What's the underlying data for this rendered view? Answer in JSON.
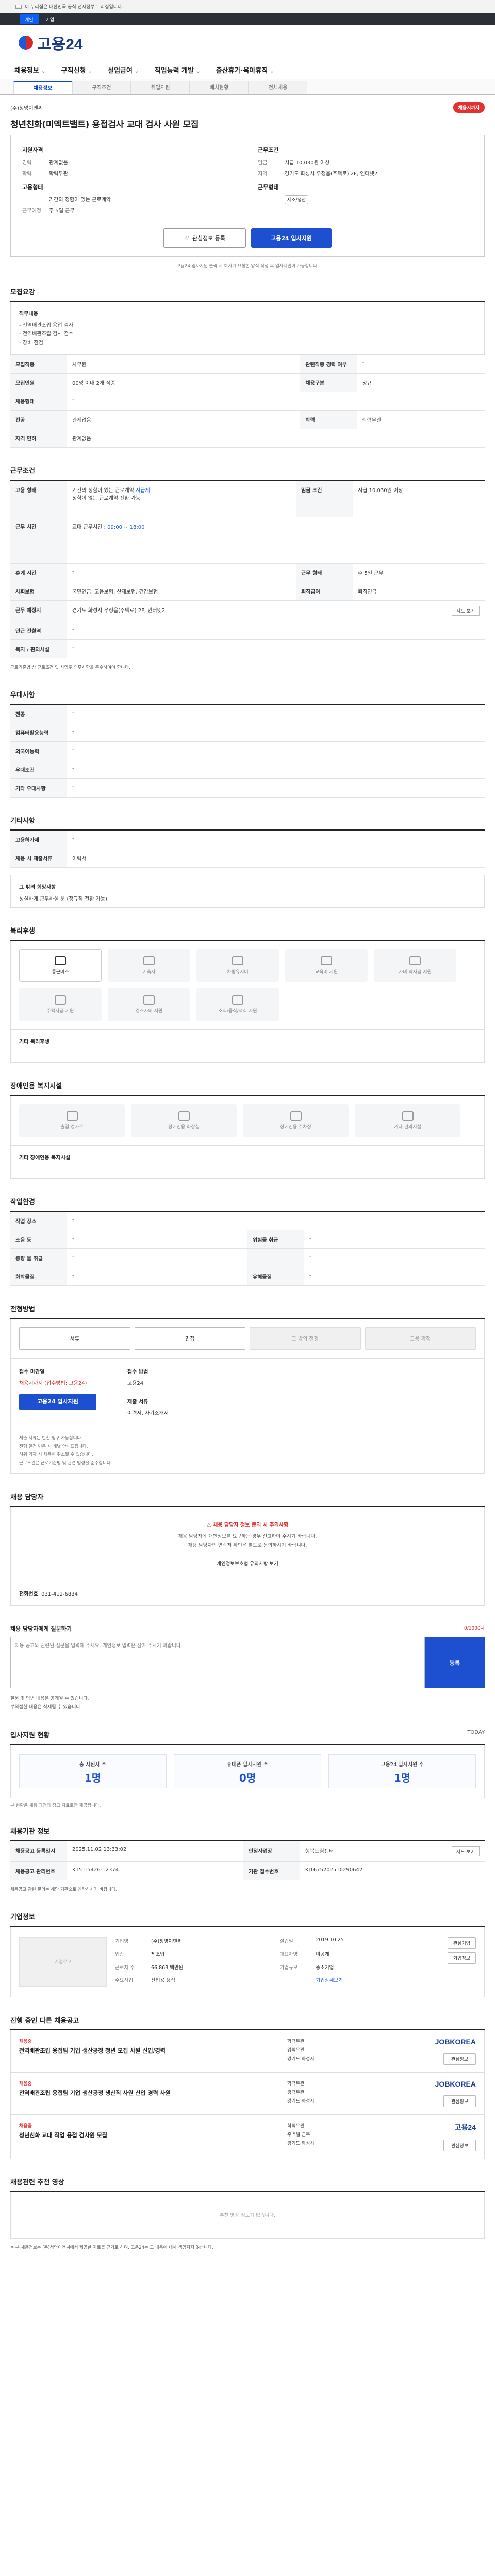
{
  "topbar": {
    "notice": "이 누리집은 대한민국 공식 전자정부 누리집입니다."
  },
  "util": {
    "items": [
      "개인",
      "기업"
    ]
  },
  "logo": {
    "text": "고용24"
  },
  "gnb": {
    "items": [
      "채용정보",
      "구직신청",
      "실업급여",
      "직업능력 개발",
      "출산휴가·육아휴직"
    ]
  },
  "subtabs": {
    "items": [
      "채용정보",
      "구직조건",
      "취업지원",
      "배치현황",
      "전체채용"
    ]
  },
  "job": {
    "company": "(주)청명이앤씨",
    "badge": "채용시까지",
    "title": "청년친화(미엑트밸트) 용접검사 교대 검사 사원 모집",
    "left_head": "지원자격",
    "right_head": "근무조건",
    "left": [
      {
        "k": "경력",
        "v": "관계없음"
      },
      {
        "k": "학력",
        "v": "학력무관"
      }
    ],
    "right": [
      {
        "k": "임금",
        "v": "시급 10,030원 이상"
      },
      {
        "k": "지역",
        "v": "경기도 화성시 우정읍(주택로) 2F, 인터넷2"
      }
    ],
    "left2_head": "고용형태",
    "right2_head": "근무형태",
    "left2": [
      {
        "k": "",
        "v": "기간의 정함이 있는 근로계약"
      },
      {
        "k": "근무예정",
        "v": "주 5일 근무"
      }
    ],
    "right2": [
      {
        "k": "",
        "v": "제조/생산"
      }
    ]
  },
  "buttons": {
    "interest": "관심정보 등록",
    "apply": "고용24 입사지원"
  },
  "note": "고용24 입사지원 클릭 시 회사가 요청한 양식 작성 후 입사지원이 가능합니다.",
  "recruit": {
    "title": "모집요강",
    "duty_label": "직무내용",
    "duties": [
      "전역배관조립 용접 검사",
      "전역배관조립 검사 검수",
      "장비 점검"
    ],
    "rows": [
      [
        "모집직종",
        "사무원",
        "관련직종 경력 여부",
        "-"
      ],
      [
        "모집인원",
        "00명 이내 2개 직종",
        "채용구분",
        "정규"
      ],
      [
        "채용형태",
        "-",
        "",
        ""
      ],
      [
        "전공",
        "관계없음",
        "학력",
        "학력무관"
      ],
      [
        "자격 면허",
        "관계없음",
        "",
        ""
      ]
    ]
  },
  "work": {
    "title": "근무조건",
    "rows": [
      {
        "h": "고용 형태",
        "v": "기간의 정함이 있는 근로계약 ",
        "b": "시급제",
        "tail": "정함이 없는 근로계약 전환 가능",
        "h2": "임금 조건",
        "v2": "시급 10,030원 이상"
      },
      {
        "h": "근무 시간",
        "v": "교대 근무시간 : ",
        "b": "09:00 ~ 18:00",
        "tail": "",
        "h2": "",
        "v2": ""
      },
      {
        "h": "휴게 시간",
        "v": "-",
        "h2": "근무 형태",
        "v2": "주 5일 근무"
      },
      {
        "h": "사회보험",
        "v": "국민연금, 고용보험, 산재보험, 건강보험",
        "h2": "퇴직급여",
        "v2": "퇴직연금"
      },
      {
        "h": "근무 예정지",
        "v": "경기도 화성시 우정읍(주택로) 2F, 인터넷2",
        "h2": "",
        "v2": ""
      },
      {
        "h": "인근 전철역",
        "v": "-",
        "h2": "",
        "v2": ""
      },
      {
        "h": "복지 / 편의시설",
        "v": "-",
        "h2": "",
        "v2": ""
      }
    ],
    "map": "지도 보기",
    "foot": "근로기준법 상 근로조건 및 사업주 의무사항을 준수하여야 합니다."
  },
  "pref": {
    "title": "우대사항",
    "rows": [
      [
        "전공",
        "-"
      ],
      [
        "컴퓨터활용능력",
        "-"
      ],
      [
        "외국어능력",
        "-"
      ],
      [
        "우대조건",
        "-"
      ],
      [
        "기타 우대사항",
        "-"
      ]
    ]
  },
  "misc": {
    "title": "기타사항",
    "rows": [
      [
        "고용허가제",
        "-"
      ],
      [
        "채용 시 제출서류",
        "이력서"
      ]
    ]
  },
  "notes_box": {
    "label": "그 밖의 희망사항",
    "text": "성실하게 근무하실 분 (정규직 전환 가능)"
  },
  "welfare": {
    "title": "복리후생",
    "items": [
      "통근버스",
      "기숙사",
      "차량유지비",
      "교육비 지원",
      "자녀 학자금 지원",
      "주택자금 지원",
      "경조사비 지원",
      "조식/중식/석식 지원"
    ],
    "other_label": "기타 복리후생"
  },
  "disabled": {
    "title": "장애인용 복지시설",
    "items": [
      "출입 경사로",
      "장애인용 화장실",
      "장애인용 주차장",
      "기타 편의시설"
    ],
    "other_label": "기타 장애인용 복지시설"
  },
  "workenv": {
    "title": "작업환경",
    "rows": [
      [
        "작업 장소",
        "-",
        "",
        ""
      ],
      [
        "소음 등",
        "-",
        "위험물 취급",
        "-"
      ],
      [
        "중량 물 취급",
        "-",
        "",
        "-"
      ],
      [
        "화학물질",
        "-",
        "유해물질",
        "-"
      ]
    ]
  },
  "process": {
    "title": "전형방법",
    "steps": [
      "서류",
      "면접",
      "그 밖의 전형",
      "고용 확정"
    ],
    "deadline_h": "접수 마감일",
    "deadline": "채용시까지 (접수방법: 고용24)",
    "method_h": "접수 방법",
    "method": "고용24",
    "apply_btn": "고용24 입사지원",
    "docs_h": "제출 서류",
    "docs": "이력서, 자기소개서",
    "notes": [
      "제출 서류는 반환 청구 가능합니다.",
      "전형 일정 변동 시 개별 안내드립니다.",
      "허위 기재 시 채용이 취소될 수 있습니다.",
      "근로조건은 근로기준법 및 관련 법령을 준수합니다."
    ]
  },
  "manager": {
    "title": "채용 담당자",
    "warn": "채용 담당자 정보 문의 시 주의사항",
    "p1": "채용 담당자에 개인정보를 요구하는 경우 신고하여 주시기 바랍니다.",
    "p2": "채용 담당자의 연락처 확인은 별도로 문의하시기 바랍니다.",
    "btn": "개인정보보호법 유의사항 보기",
    "tel_h": "전화번호",
    "tel": "031-412-6834"
  },
  "qa": {
    "title": "채용 담당자에게 질문하기",
    "count": "0/1000자",
    "placeholder": "채용 공고와 관련된 질문을 입력해 주세요. 개인정보 입력은 삼가 주시기 바랍니다.",
    "submit": "등록",
    "notes": [
      "질문 및 답변 내용은 공개될 수 있습니다.",
      "부적절한 내용은 삭제될 수 있습니다."
    ]
  },
  "stats": {
    "title": "입사지원 현황",
    "today": "TODAY",
    "items": [
      {
        "label": "총 지원자 수",
        "value": "1명"
      },
      {
        "label": "휴대폰 입사지원 수",
        "value": "0명"
      },
      {
        "label": "고용24 입사지원 수",
        "value": "1명"
      }
    ],
    "note": "본 현황은 채용 과정의 참고 자료로만 제공됩니다."
  },
  "reg": {
    "title": "채용기관 정보",
    "rows": [
      [
        "채용공고 등록일시",
        "2025.11.02 13:33:02",
        "인정사업장",
        "행복드림센터"
      ],
      [
        "채용공고 관리번호",
        "K151-5426-12374",
        "기관 접수번호",
        "KJ1675202510290642"
      ]
    ],
    "btn": "지도 보기",
    "note": "채용공고 관련 문의는 해당 기관으로 연락하시기 바랍니다."
  },
  "company": {
    "title": "기업정보",
    "logo": "기업로고",
    "kv": [
      [
        "기업명",
        "(주)청명이앤씨"
      ],
      [
        "업종",
        "제조업"
      ],
      [
        "근로자 수",
        "66,863 백만원"
      ],
      [
        "설립일",
        "2019.10.25"
      ],
      [
        "대표자명",
        "미공개"
      ],
      [
        "기업규모",
        "중소기업"
      ],
      [
        "주요사업",
        "산업용 용접"
      ],
      [
        "",
        "기업상세보기"
      ]
    ],
    "btns": [
      "관심기업",
      "기업정보"
    ]
  },
  "similar": {
    "title": "진행 중인 다른 채용공고",
    "items": [
      {
        "tag": "채용중",
        "title": "전역배관조립 용접팀 기업 생산공정 청년 모집 사원 신입/경력",
        "meta": [
          "학력무관",
          "경력무관",
          "경기도 화성시"
        ],
        "logo": "JOBKOREA",
        "tail": "관심정보"
      },
      {
        "tag": "채용중",
        "title": "전역배관조립 용접팀 기업 생산공정 생산직 사원 신입 경력 사원",
        "meta": [
          "학력무관",
          "경력무관",
          "경기도 화성시"
        ],
        "logo": "JOBKOREA",
        "tail": "관심정보"
      },
      {
        "tag": "채용중",
        "title": "청년친화 교대 작업 용접 검사원 모집",
        "meta": [
          "학력무관",
          "주 5일 근무",
          "경기도 화성시"
        ],
        "logo": "고용24",
        "tail": "관심정보"
      }
    ]
  },
  "video": {
    "title": "채용관련 추천 영상",
    "empty": "추천 영상 정보가 없습니다."
  },
  "footnote": "※ 본 채용정보는 (주)청명이앤씨에서 제공한 자료를 근거로 하며, 고용24는 그 내용에 대해 책임지지 않습니다."
}
